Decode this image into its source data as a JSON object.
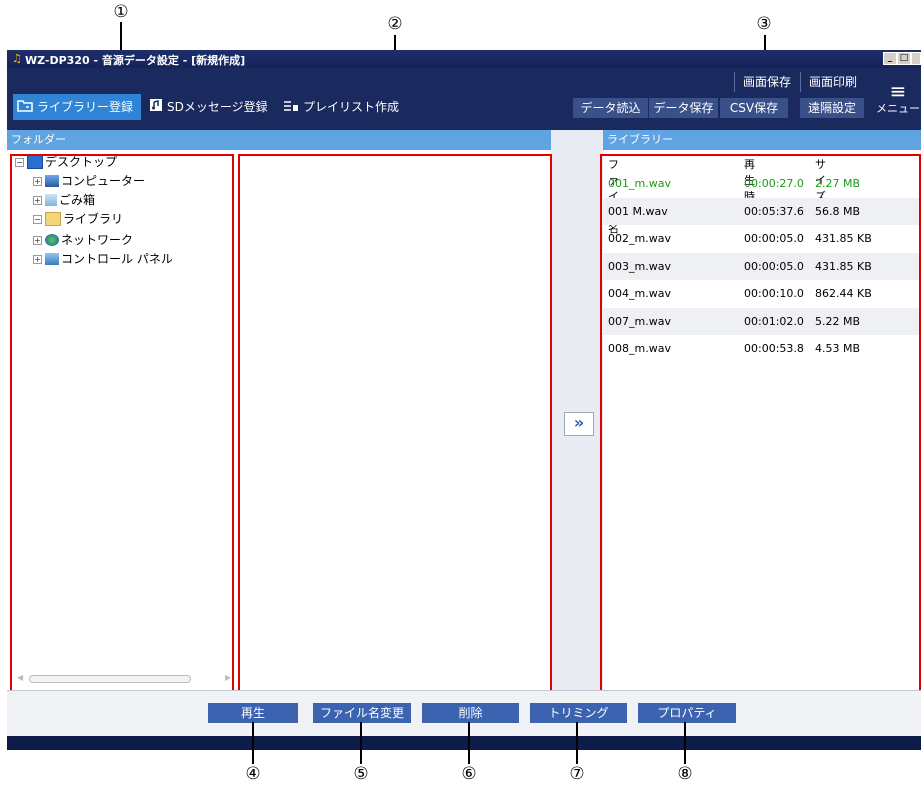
{
  "callouts": [
    "①",
    "②",
    "③",
    "④",
    "⑤",
    "⑥",
    "⑦",
    "⑧"
  ],
  "window": {
    "title": "WZ-DP320 - 音源データ設定 - [新規作成]"
  },
  "header": {
    "tabs": [
      {
        "label": "ライブラリー登録",
        "icon": "library-icon"
      },
      {
        "label": "SDメッセージ登録",
        "icon": "sd-message-icon"
      },
      {
        "label": "プレイリスト作成",
        "icon": "playlist-icon"
      }
    ],
    "top_buttons": [
      "画面保存",
      "画面印刷"
    ],
    "buttons": [
      "データ読込",
      "データ保存",
      "CSV保存",
      "遠隔設定"
    ],
    "menu_label": "メニュー"
  },
  "folder_pane": {
    "title": "フォルダー",
    "tree": [
      {
        "label": "デスクトップ",
        "icon": "desktop-icon",
        "expander": "⊟"
      },
      {
        "label": "コンピューター",
        "icon": "computer-icon",
        "expander": "⊞"
      },
      {
        "label": "ごみ箱",
        "icon": "trash-icon",
        "expander": "⊞"
      },
      {
        "label": "ライブラリ",
        "icon": "folder-icon",
        "expander": "⊟"
      },
      {
        "label": "ネットワーク",
        "icon": "network-icon",
        "expander": "⊞"
      },
      {
        "label": "コントロール パネル",
        "icon": "control-panel-icon",
        "expander": "⊞"
      }
    ]
  },
  "add_button": "»",
  "library": {
    "title": "ライブラリー",
    "columns": [
      "ファイル名",
      "再生時間",
      "サイズ"
    ],
    "rows": [
      {
        "name": "001_m.wav",
        "time": "00:00:27.0",
        "size": "2.27 MB",
        "highlight": true
      },
      {
        "name": "001 M.wav",
        "time": "00:05:37.6",
        "size": "56.8 MB"
      },
      {
        "name": "002_m.wav",
        "time": "00:00:05.0",
        "size": "431.85 KB"
      },
      {
        "name": "003_m.wav",
        "time": "00:00:05.0",
        "size": "431.85 KB"
      },
      {
        "name": "004_m.wav",
        "time": "00:00:10.0",
        "size": "862.44 KB"
      },
      {
        "name": "007_m.wav",
        "time": "00:01:02.0",
        "size": "5.22 MB"
      },
      {
        "name": "008_m.wav",
        "time": "00:00:53.8",
        "size": "4.53 MB"
      }
    ]
  },
  "bottom_buttons": [
    "再生",
    "ファイル名変更",
    "削除",
    "トリミング",
    "プロパティ"
  ],
  "colors": {
    "highlight_text": "#1a9a1a",
    "accent": "#2f84d6",
    "callout_box": "#e00000"
  }
}
